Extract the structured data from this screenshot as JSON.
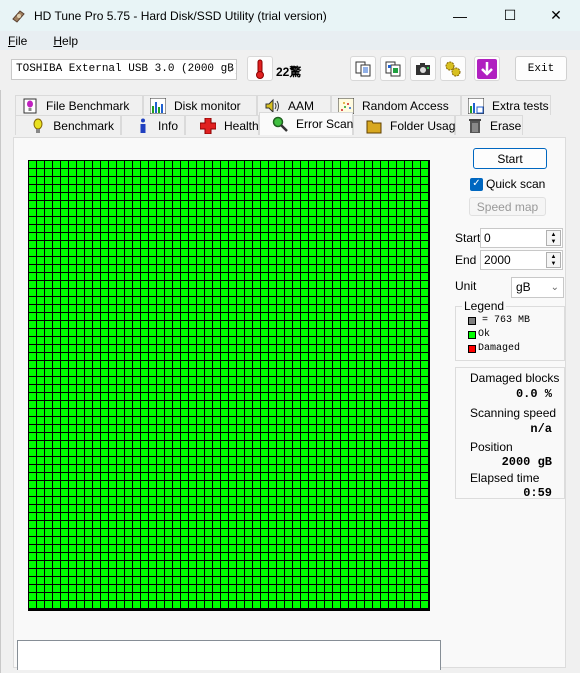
{
  "window": {
    "title": "HD Tune Pro 5.75 - Hard Disk/SSD Utility (trial version)",
    "controls": {
      "minimize": "—",
      "maximize": "☐",
      "close": "✕"
    }
  },
  "menu": [
    {
      "label": "File",
      "accel": "F",
      "rest": "ile"
    },
    {
      "label": "Help",
      "accel": "H",
      "rest": "elp"
    }
  ],
  "toolbar": {
    "drive": "TOSHIBA External USB 3.0 (2000 gB)",
    "temperature": "22驚",
    "temperature_icon": "thermometer-icon",
    "buttons": [
      {
        "name": "copy-text-button",
        "icon": "copy-text-icon"
      },
      {
        "name": "copy-screenshot-button",
        "icon": "copy-image-icon"
      },
      {
        "name": "screenshot-button",
        "icon": "camera-icon"
      },
      {
        "name": "options-button",
        "icon": "gears-icon"
      },
      {
        "name": "save-button",
        "icon": "download-arrow-icon"
      }
    ],
    "exit_label": "Exit"
  },
  "tabs": {
    "row1": [
      {
        "label": "File Benchmark",
        "icon": "file-benchmark-icon"
      },
      {
        "label": "Disk monitor",
        "icon": "disk-monitor-icon"
      },
      {
        "label": "AAM",
        "icon": "speaker-icon"
      },
      {
        "label": "Random Access",
        "icon": "random-access-icon"
      },
      {
        "label": "Extra tests",
        "icon": "extra-tests-icon"
      }
    ],
    "row2": [
      {
        "label": "Benchmark",
        "icon": "lightbulb-icon"
      },
      {
        "label": "Info",
        "icon": "info-icon"
      },
      {
        "label": "Health",
        "icon": "health-cross-icon"
      },
      {
        "label": "Error Scan",
        "icon": "magnifier-icon",
        "active": true
      },
      {
        "label": "Folder Usage",
        "icon": "folder-icon"
      },
      {
        "label": "Erase",
        "icon": "trash-icon"
      }
    ]
  },
  "scan": {
    "columns": 50,
    "rows": 56,
    "block_states": "all-ok",
    "colors": {
      "ok": "#00ff00",
      "damaged": "#ff0000",
      "unscanned": "#808080",
      "grid_line": "#000000"
    }
  },
  "controls": {
    "start_label": "Start",
    "quick_scan_label": "Quick scan",
    "quick_scan_checked": true,
    "speed_map_label": "Speed map",
    "start_field_label": "Start",
    "start_value": "0",
    "end_field_label": "End",
    "end_value": "2000",
    "unit_label": "Unit",
    "unit_value": "gB"
  },
  "legend": {
    "title": "Legend",
    "items": [
      {
        "label": "= 763 MB",
        "color": "#808080"
      },
      {
        "label": "Ok",
        "color": "#00ff00"
      },
      {
        "label": "Damaged",
        "color": "#ff0000"
      }
    ]
  },
  "stats": {
    "damaged_blocks_label": "Damaged blocks",
    "damaged_blocks_value": "0.0 %",
    "scanning_speed_label": "Scanning speed",
    "scanning_speed_value": "n/a",
    "position_label": "Position",
    "position_value": "2000 gB",
    "elapsed_label": "Elapsed time",
    "elapsed_value": "0:59"
  },
  "log": {
    "text": ""
  }
}
